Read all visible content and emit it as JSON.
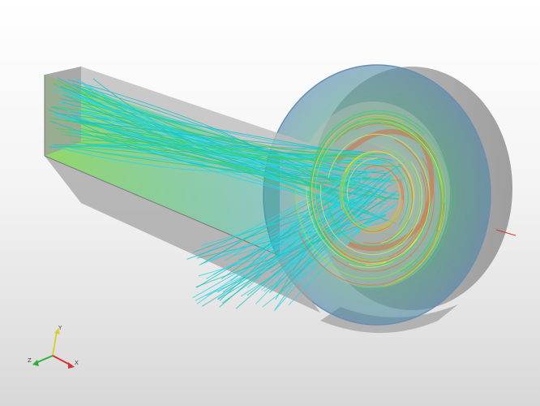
{
  "viewport": {
    "background_top": "#ffffff",
    "background_bottom": "#d8d8d8"
  },
  "model": {
    "housing_color": "#9a9a9a",
    "streamline_palette": [
      "#29d7e6",
      "#22c3c0",
      "#3fcf6a",
      "#8ee04a",
      "#d6e25a",
      "#e9b347",
      "#e07a3b"
    ]
  },
  "axes_triad": {
    "x_color": "#d63333",
    "y_color": "#d7cf3b",
    "z_color": "#2fae3a",
    "x_label": "X",
    "y_label": "Y",
    "z_label": "Z"
  }
}
